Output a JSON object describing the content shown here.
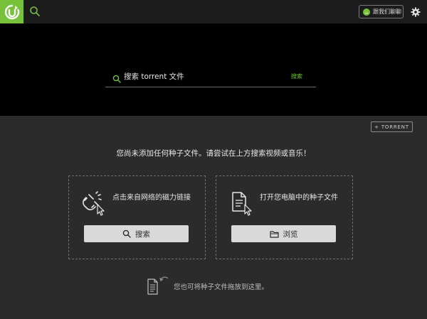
{
  "topbar": {
    "logo_icon": "utorrent-logo-icon",
    "search_icon": "search-icon",
    "chat_label": "跟我们聊聊",
    "settings_icon": "gear-icon"
  },
  "search": {
    "placeholder": "搜索 torrent 文件",
    "go_label": "搜索"
  },
  "add_torrent_label": "+ TORRENT",
  "empty_message": "您尚未添加任何种子文件。请尝试在上方搜索视频或音乐！",
  "cards": {
    "magnet": {
      "text": "点击来自网络的磁力链接",
      "button_label": "搜索",
      "icon": "magnet-cursor-icon",
      "button_icon": "search-icon"
    },
    "file": {
      "text": "打开您电脑中的种子文件",
      "button_label": "浏览",
      "icon": "document-cursor-icon",
      "button_icon": "folder-icon"
    }
  },
  "drop_hint": "您也可将种子文件拖放到这里。",
  "colors": {
    "accent": "#78c13b",
    "background": "#2b2b2b",
    "hero": "#000000",
    "topbar": "#1c1c1c",
    "button": "#d9d9d9"
  }
}
